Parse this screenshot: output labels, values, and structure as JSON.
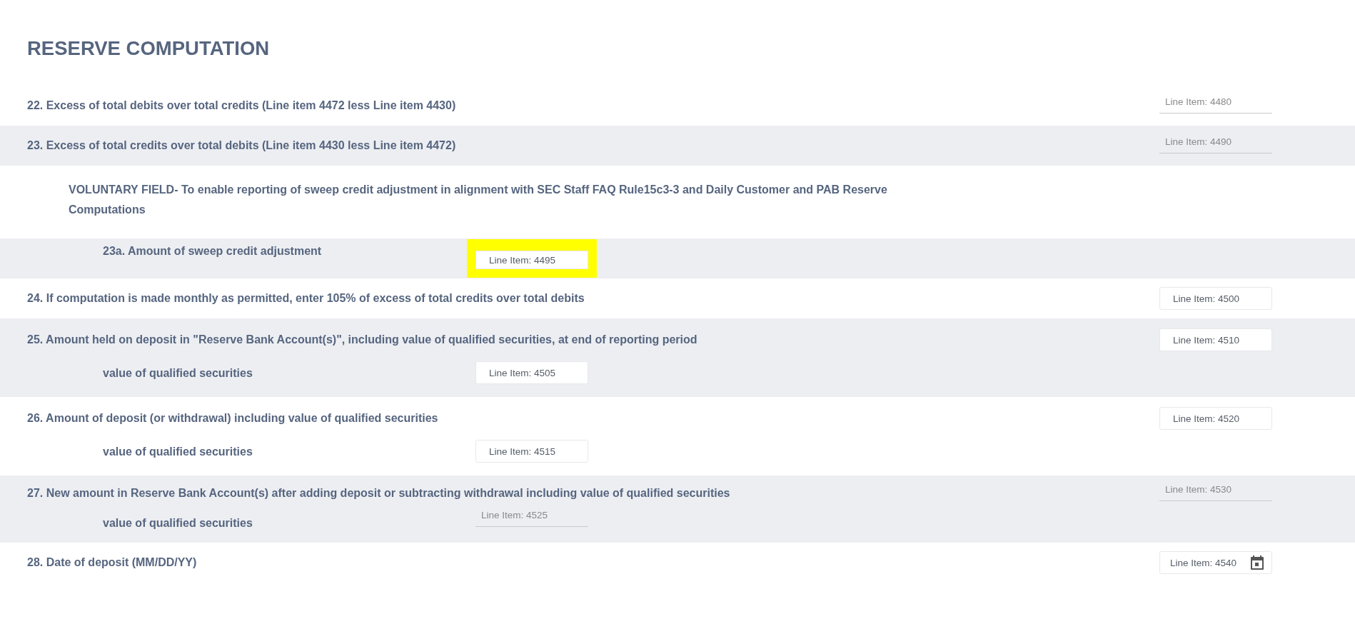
{
  "heading": "RESERVE COMPUTATION",
  "rows": [
    {
      "kind": "line",
      "label": "22. Excess of total debits over total credits (Line item 4472 less Line item 4430)",
      "field": {
        "kind": "underline",
        "placeholder": "Line Item: 4480",
        "highlighted": false
      }
    },
    {
      "kind": "line",
      "label": "23. Excess of total credits over total debits (Line item 4430 less Line item 4472)",
      "field": {
        "kind": "underline",
        "placeholder": "Line Item: 4490",
        "highlighted": false
      }
    },
    {
      "kind": "note",
      "label": "VOLUNTARY FIELD- To enable reporting of sweep credit adjustment in alignment with SEC Staff FAQ Rule15c3-3 and Daily Customer and PAB Reserve Computations"
    },
    {
      "kind": "subline",
      "label": "23a. Amount of sweep credit adjustment",
      "field": {
        "kind": "box",
        "placeholder": "Line Item: 4495",
        "highlighted": true
      }
    },
    {
      "kind": "line",
      "label": "24. If computation is made monthly as permitted, enter 105% of excess of total credits over total debits",
      "field": {
        "kind": "box",
        "placeholder": "Line Item: 4500",
        "highlighted": false
      }
    },
    {
      "kind": "line",
      "label": "25. Amount held on deposit in \"Reserve Bank Account(s)\", including value of qualified securities, at end of reporting period",
      "field": {
        "kind": "box",
        "placeholder": "Line Item: 4510",
        "highlighted": false
      },
      "sub": {
        "label": "value of qualified securities",
        "field": {
          "kind": "box",
          "placeholder": "Line Item: 4505",
          "highlighted": false
        }
      }
    },
    {
      "kind": "line",
      "label": "26. Amount of deposit (or withdrawal) including value of qualified securities",
      "field": {
        "kind": "box",
        "placeholder": "Line Item: 4520",
        "highlighted": false
      },
      "sub": {
        "label": "value of qualified securities",
        "field": {
          "kind": "box",
          "placeholder": "Line Item: 4515",
          "highlighted": false
        }
      }
    },
    {
      "kind": "line",
      "label": "27. New amount in Reserve Bank Account(s) after adding deposit or subtracting withdrawal including value of qualified securities",
      "field": {
        "kind": "underline",
        "placeholder": "Line Item: 4530",
        "highlighted": false
      },
      "sub": {
        "label": "value of qualified securities",
        "field": {
          "kind": "underline",
          "placeholder": "Line Item: 4525",
          "highlighted": false
        }
      }
    },
    {
      "kind": "line",
      "label": "28. Date of deposit (MM/DD/YY)",
      "field": {
        "kind": "date",
        "placeholder": "Line Item: 4540",
        "highlighted": false
      }
    }
  ]
}
